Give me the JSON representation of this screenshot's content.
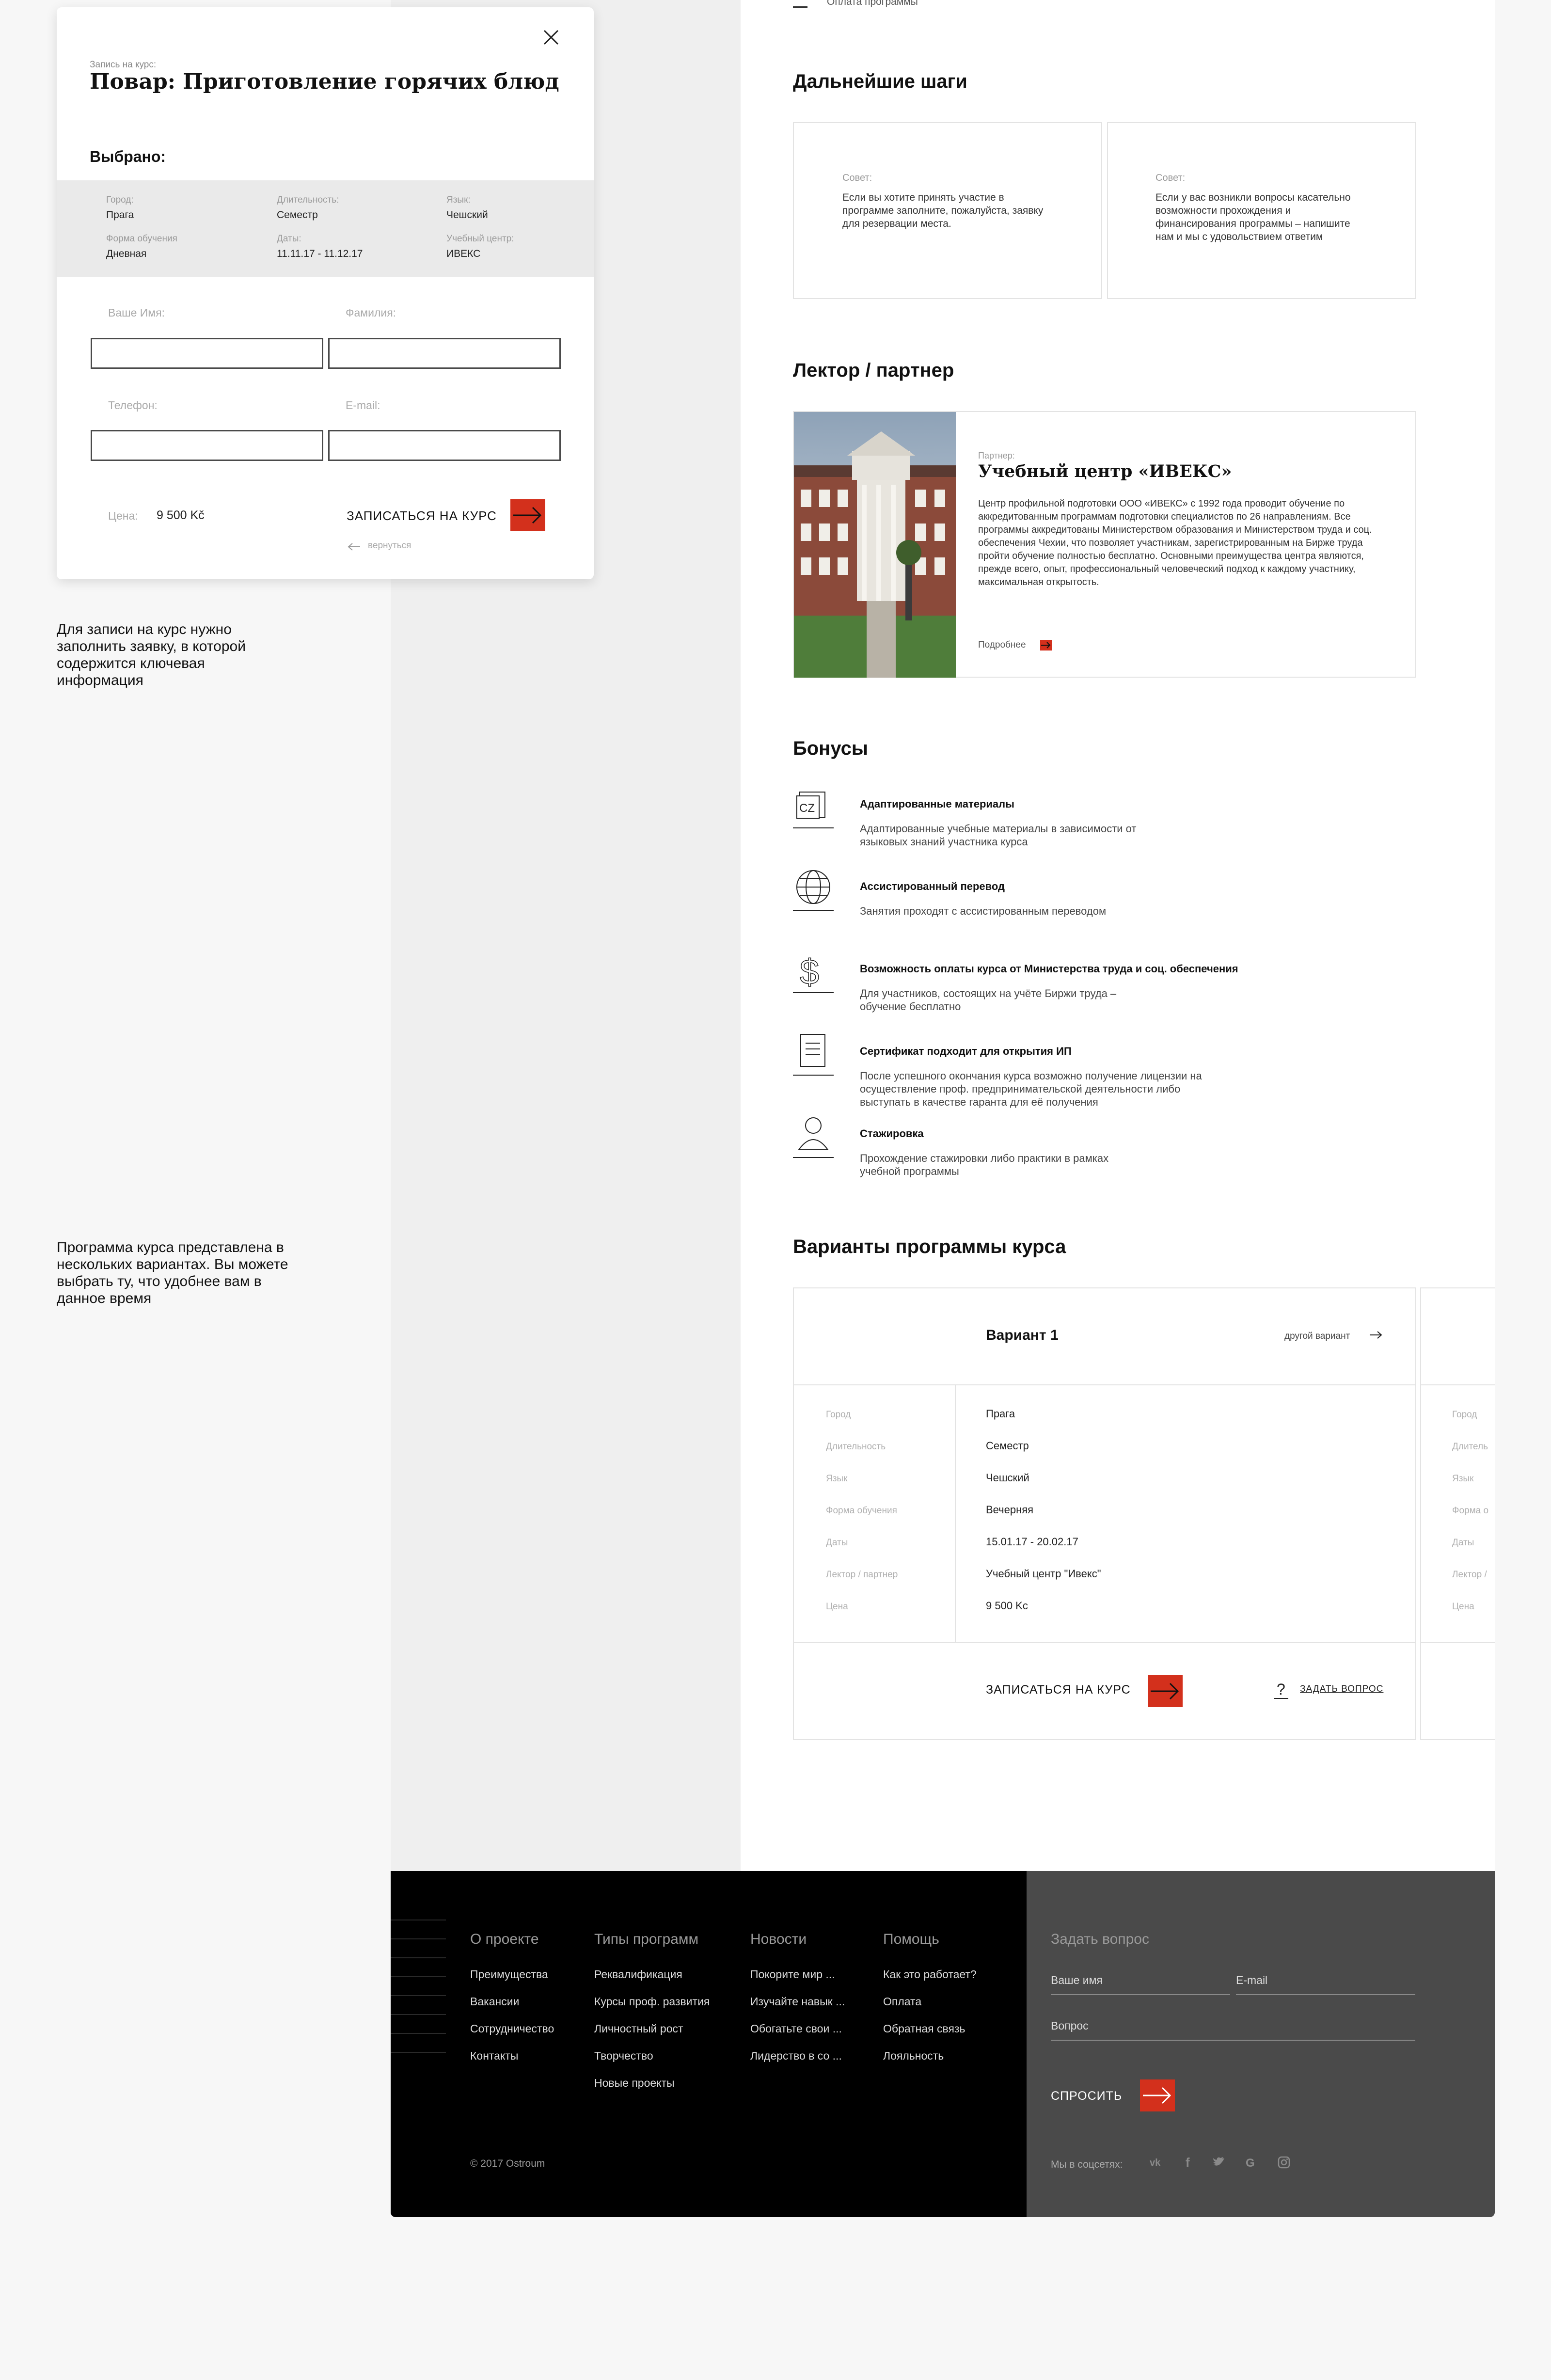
{
  "top_partial": "Оплата программы",
  "modal": {
    "overline": "Запись на курс:",
    "title": "Повар: Приготовление горячих блюд",
    "selected_heading": "Выбрано:",
    "details": [
      {
        "label": "Город:",
        "value": "Прага"
      },
      {
        "label": "Длительность:",
        "value": "Семестр"
      },
      {
        "label": "Язык:",
        "value": "Чешский"
      },
      {
        "label": "Форма обучения",
        "value": "Дневная"
      },
      {
        "label": "Даты:",
        "value": "11.11.17 - 11.12.17"
      },
      {
        "label": "Учебный центр:",
        "value": "ИВЕКС"
      }
    ],
    "fields": {
      "first_name": "Ваше Имя:",
      "last_name": "Фамилия:",
      "phone": "Телефон:",
      "email": "E-mail:"
    },
    "price_label": "Цена:",
    "price_value": "9 500 Kč",
    "submit_label": "ЗАПИСАТЬСЯ НА КУРС",
    "back_label": "вернуться"
  },
  "notes": {
    "note1": "Для записи на курс нужно заполнить заявку, в которой содержится ключевая информация",
    "note2": "Программа курса представлена в нескольких вариантах. Вы можете выбрать ту, что удобнее вам в данное время"
  },
  "next_steps": {
    "title": "Дальнейшие шаги",
    "cards": [
      {
        "label": "Совет:",
        "text": "Если вы хотите принять участие в программе заполните, пожалуйста, заявку для резервации места."
      },
      {
        "label": "Совет:",
        "text": "Если у вас возникли вопросы касательно возможности прохождения и финансирования программы – напишите нам и мы с удовольствием ответим"
      }
    ]
  },
  "lecturer": {
    "title": "Лектор / партнер",
    "label": "Партнер:",
    "name": "Учебный центр «ИВЕКС»",
    "desc": "Центр профильной подготовки ООО «ИВЕКС» с 1992 года проводит обучение по аккредитованным программам подготовки специалистов по 26 направлениям. Все программы аккредитованы Министерством образования и Министерством труда и соц. обеспечения Чехии, что позволяет участникам, зарегистрированным на Бирже труда пройти обучение полностью бесплатно. Основными преимущества центра являются, прежде всего, опыт, профессиональный человеческий подход к каждому участнику, максимальная открытость.",
    "more": "Подробнее"
  },
  "bonuses": {
    "title": "Бонусы",
    "items": [
      {
        "icon": "book-cz-icon",
        "glyph": "CZ",
        "title": "Адаптированные материалы",
        "desc": "Адаптированные учебные материалы в зависимости от языковых знаний участника курса"
      },
      {
        "icon": "globe-icon",
        "glyph": "",
        "title": "Ассистированный перевод",
        "desc": "Занятия проходят с ассистированным переводом"
      },
      {
        "icon": "dollar-icon",
        "glyph": "$",
        "title": "Возможность оплаты курса от Министерства труда и соц. обеспечения",
        "desc": "Для участников, состоящих на учёте Биржи труда – обучение бесплатно"
      },
      {
        "icon": "document-icon",
        "glyph": "",
        "title": "Сертификат подходит для открытия ИП",
        "desc": "После успешного окончания курса возможно получение лицензии на осуществление проф. предпринимательской деятельности либо выступать в качестве гаранта для её получения"
      },
      {
        "icon": "user-icon",
        "glyph": "",
        "title": "Стажировка",
        "desc": "Прохождение стажировки либо практики в рамках учебной программы"
      }
    ]
  },
  "variants": {
    "title": "Варианты программы курса",
    "name": "Вариант 1",
    "other": "другой вариант",
    "rows": [
      {
        "label": "Город",
        "value": "Прага"
      },
      {
        "label": "Длительность",
        "value": "Семестр"
      },
      {
        "label": "Язык",
        "value": "Чешский"
      },
      {
        "label": "Форма обучения",
        "value": "Вечерняя"
      },
      {
        "label": "Даты",
        "value": "15.01.17 - 20.02.17"
      },
      {
        "label": "Лектор / партнер",
        "value": "Учебный центр \"Ивекс\""
      },
      {
        "label": "Цена",
        "value": "9 500 Kc"
      }
    ],
    "partial_labels": [
      "Город",
      "Длитель",
      "Язык",
      "Форма о",
      "Даты",
      "Лектор /",
      "Цена"
    ],
    "submit": "ЗАПИСАТЬСЯ НА КУРС",
    "ask": "ЗАДАТЬ ВОПРОС"
  },
  "footer": {
    "columns": [
      {
        "heading": "О проекте",
        "links": [
          "Преимущества",
          "Вакансии",
          "Сотрудничество",
          "Контакты"
        ]
      },
      {
        "heading": "Типы программ",
        "links": [
          "Реквалификация",
          "Курсы проф. развития",
          "Личностный рост",
          "Творчество",
          "Новые проекты"
        ]
      },
      {
        "heading": "Новости",
        "links": [
          "Покорите мир ...",
          "Изучайте навык ...",
          "Обогатьте свои ...",
          "Лидерство в со ..."
        ]
      },
      {
        "heading": "Помощь",
        "links": [
          "Как это работает?",
          "Оплата",
          "Обратная связь",
          "Лояльность"
        ]
      }
    ],
    "copyright": "© 2017 Ostroum",
    "ask": {
      "heading": "Задать вопрос",
      "name_ph": "Ваше имя",
      "email_ph": "E-mail",
      "question_ph": "Вопрос",
      "button": "СПРОСИТЬ"
    },
    "social_label": "Мы в соцсетях:",
    "social": [
      "vk-icon",
      "facebook-icon",
      "twitter-icon",
      "google-icon",
      "instagram-icon"
    ]
  },
  "colors": {
    "accent": "#d3301c",
    "footer_dark": "#000000",
    "footer_grey": "#4a4a4a"
  }
}
